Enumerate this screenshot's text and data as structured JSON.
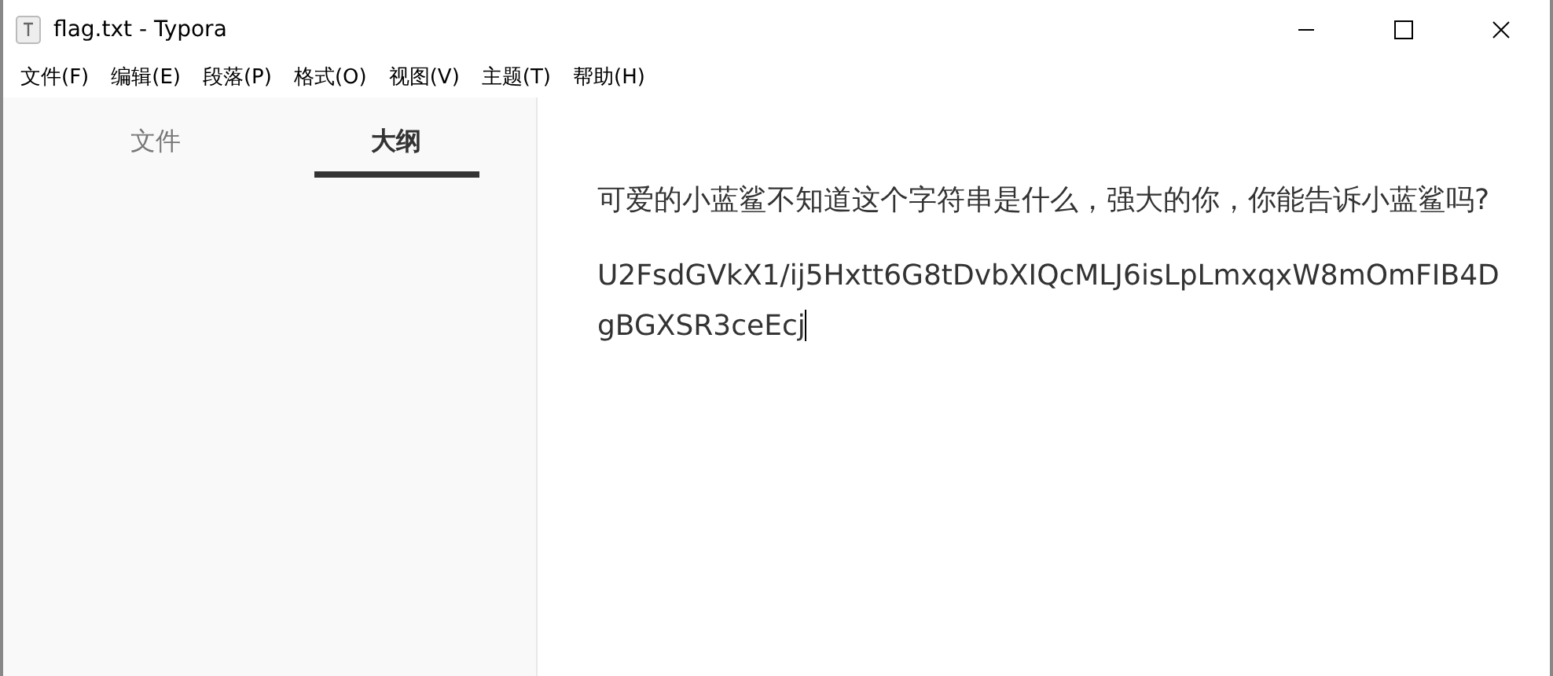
{
  "window": {
    "title": "flag.txt - Typora"
  },
  "menu": [
    "文件(F)",
    "编辑(E)",
    "段落(P)",
    "格式(O)",
    "视图(V)",
    "主题(T)",
    "帮助(H)"
  ],
  "sidebar_tabs": [
    {
      "label": "文件",
      "selected": false
    },
    {
      "label": "大纲",
      "selected": true
    }
  ],
  "document": {
    "paragraphs": [
      "可爱的小蓝鲨不知道这个字符串是什么，强大的你，你能告诉小蓝鲨吗?",
      "U2FsdGVkX1/ij5Hxtt6G8tDvbXIQcMLJ6isLpLmxqxW8mOmFIB4DgBGXSR3ceEcj"
    ]
  }
}
